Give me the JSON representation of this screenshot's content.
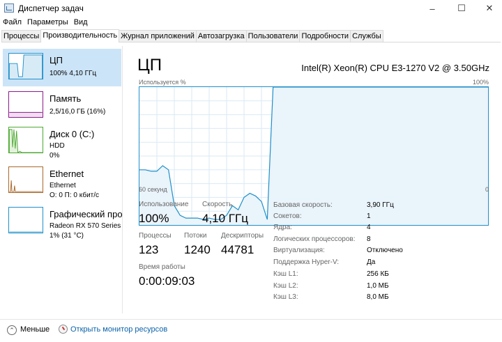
{
  "window": {
    "title": "Диспетчер задач",
    "buttons": [
      "–",
      "☐",
      "✕"
    ]
  },
  "menu": [
    "Файл",
    "Параметры",
    "Вид"
  ],
  "tabs": [
    "Процессы",
    "Производительность",
    "Журнал приложений",
    "Автозагрузка",
    "Пользователи",
    "Подробности",
    "Службы"
  ],
  "active_tab": "Производительность",
  "sidebar": {
    "cpu": {
      "title": "ЦП",
      "line1": "100%  4,10 ГГц",
      "color": "#1f8fc8"
    },
    "memory": {
      "title": "Память",
      "line1": "2,5/16,0 ГБ (16%)",
      "color": "#8b1a8b"
    },
    "disk": {
      "title": "Диск 0 (C:)",
      "line1": "HDD",
      "line2": "0%",
      "color": "#4da832"
    },
    "ethernet": {
      "title": "Ethernet",
      "line1": "Ethernet",
      "line2": "О: 0  П: 0 кбит/с",
      "color": "#a7672a"
    },
    "gpu": {
      "title": "Графический проц",
      "line1": "Radeon RX 570 Series",
      "line2": "1% (31 °C)",
      "color": "#1f8fc8"
    }
  },
  "main": {
    "title": "ЦП",
    "cpu_name": "Intel(R) Xeon(R) CPU E3-1270 V2 @ 3.50GHz",
    "graph": {
      "label_top_left": "Используется %",
      "label_top_right": "100%",
      "label_bottom_left": "60 секунд",
      "label_bottom_right": "0",
      "usage_percent_history": [
        40,
        40,
        39,
        39,
        43,
        40,
        14,
        7,
        5,
        5,
        5,
        4,
        5,
        4,
        4,
        7,
        14,
        11,
        20,
        23,
        21,
        17,
        4,
        100,
        100,
        100,
        100,
        100,
        100,
        100,
        100,
        100,
        100,
        100,
        100,
        100,
        100,
        100,
        100,
        100,
        100,
        100,
        100,
        100,
        100,
        100,
        100,
        100,
        100,
        100,
        100,
        100,
        100,
        100,
        100,
        100,
        100,
        100,
        100,
        100,
        100
      ]
    },
    "stats": {
      "usage_label": "Использование",
      "usage_value": "100%",
      "speed_label": "Скорость",
      "speed_value": "4,10 ГГц",
      "processes_label": "Процессы",
      "processes_value": "123",
      "threads_label": "Потоки",
      "threads_value": "1240",
      "handles_label": "Дескрипторы",
      "handles_value": "44781",
      "uptime_label": "Время работы",
      "uptime_value": "0:00:09:03"
    },
    "details": [
      {
        "label": "Базовая скорость:",
        "value": "3,90 ГГц"
      },
      {
        "label": "Сокетов:",
        "value": "1"
      },
      {
        "label": "Ядра:",
        "value": "4"
      },
      {
        "label": "Логических процессоров:",
        "value": "8"
      },
      {
        "label": "Виртуализация:",
        "value": "Отключено"
      },
      {
        "label": "Поддержка Hyper-V:",
        "value": "Да"
      },
      {
        "label": "Кэш L1:",
        "value": "256 КБ"
      },
      {
        "label": "Кэш L2:",
        "value": "1,0 МБ"
      },
      {
        "label": "Кэш L3:",
        "value": "8,0 МБ"
      }
    ]
  },
  "footer": {
    "less_label": "Меньше",
    "monitor_link": "Открыть монитор ресурсов"
  }
}
